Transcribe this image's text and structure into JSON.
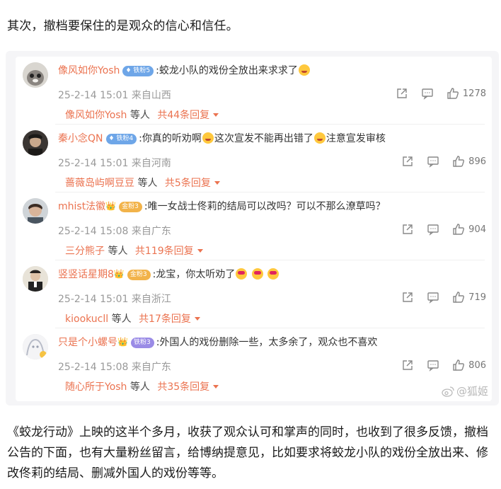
{
  "intro_text": "其次，撤档要保住的是观众的信心和信任。",
  "comments": [
    {
      "username": "像风如你Yosh",
      "badge": "铁粉5",
      "text": ":蛟龙小队的戏份全放出来求求了",
      "date": "25-2-14 15:01",
      "location": "来自山西",
      "likes": "1278",
      "reply_user": "像风如你Yosh",
      "reply_connector": "等人",
      "reply_count": "共44条回复"
    },
    {
      "username": "秦小念QN",
      "badge": "铁粉4",
      "text_a": ":你真的听劝啊",
      "text_b": "这次宣发不能再出错了",
      "text_c": "注意宣发审核",
      "date": "25-2-14 15:01",
      "location": "来自河南",
      "likes": "896",
      "reply_user": "蔷薇岛屿啊豆豆",
      "reply_connector": "等人",
      "reply_count": "共5条回复"
    },
    {
      "username": "mhist法徽",
      "badge": "金粉3",
      "text": ":唯一女战士佟莉的结局可以改吗？可以不那么潦草吗？",
      "date": "25-2-14 15:08",
      "location": "来自广东",
      "likes": "904",
      "reply_user": "三分熊子",
      "reply_connector": "等人",
      "reply_count": "共119条回复"
    },
    {
      "username": "竖竖话星期8",
      "badge": "金粉3",
      "text": ":龙宝，你太听劝了",
      "date": "25-2-14 15:01",
      "location": "来自浙江",
      "likes": "719",
      "reply_user": "kiookucll",
      "reply_connector": "等人",
      "reply_count": "共17条回复"
    },
    {
      "username": "只是个小螺号",
      "badge": "铁粉3",
      "text": ":外国人的戏份删除一些，太多余了，观众也不喜欢",
      "date": "25-2-14 15:08",
      "location": "来自广东",
      "likes": "806",
      "reply_user": "随心所于Yosh",
      "reply_connector": "等人",
      "reply_count": "共35条回复"
    }
  ],
  "watermark": "@狐姬",
  "outro_text": "《蛟龙行动》上映的这半个多月，收获了观众认可和掌声的同时，也收到了很多反馈，撤档公告的下面，也有大量粉丝留言，给博纳提意见，比如要求将蛟龙小队的戏份全放出来、修改佟莉的结局、删减外国人的戏份等等。",
  "icons": [
    "share-icon",
    "comment-icon",
    "like-icon"
  ],
  "colors": {
    "accent": "#eb7350",
    "meta": "#999999",
    "card_bg": "#f5f5f7"
  }
}
